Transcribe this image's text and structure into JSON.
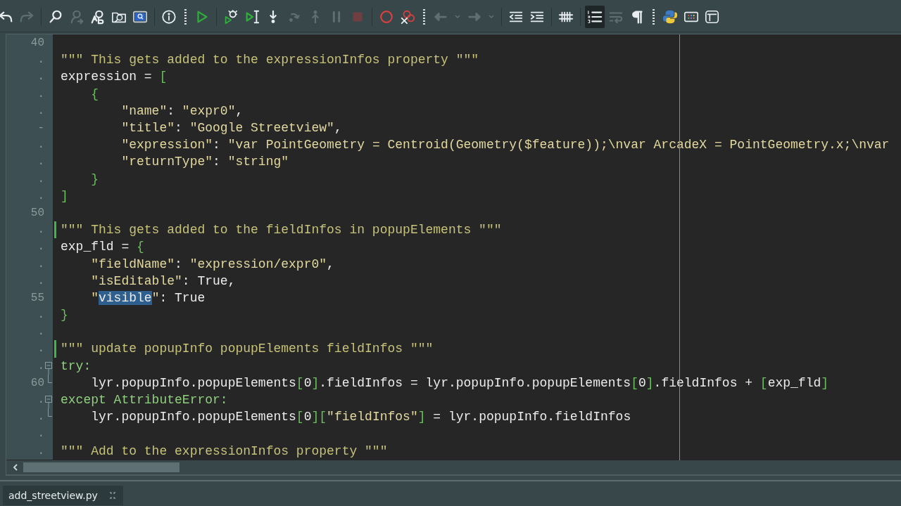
{
  "toolbar": {
    "groups": [
      {
        "kind": "plain",
        "buttons": [
          {
            "kind": "undo",
            "disabled": false,
            "selected": false
          },
          {
            "kind": "redo",
            "disabled": true,
            "selected": false
          }
        ]
      },
      {
        "kind": "plain",
        "buttons": [
          {
            "kind": "find",
            "disabled": false,
            "selected": false
          },
          {
            "kind": "find-user",
            "disabled": true,
            "selected": false
          },
          {
            "kind": "replace",
            "disabled": false,
            "selected": false
          },
          {
            "kind": "find-files",
            "disabled": false,
            "selected": false
          },
          {
            "kind": "search-box",
            "disabled": false,
            "selected": false
          }
        ]
      },
      {
        "kind": "plain",
        "buttons": [
          {
            "kind": "info",
            "disabled": false,
            "selected": false
          }
        ]
      },
      {
        "kind": "grip",
        "buttons": [
          {
            "kind": "run",
            "disabled": false,
            "selected": false
          }
        ]
      },
      {
        "kind": "plain",
        "buttons": [
          {
            "kind": "debug",
            "disabled": false,
            "selected": false
          },
          {
            "kind": "run-to-cursor",
            "disabled": false,
            "selected": false
          },
          {
            "kind": "step-into",
            "disabled": false,
            "selected": false
          },
          {
            "kind": "step-over",
            "disabled": true,
            "selected": false
          },
          {
            "kind": "step-out",
            "disabled": true,
            "selected": false
          },
          {
            "kind": "pause",
            "disabled": true,
            "selected": false
          },
          {
            "kind": "stop",
            "disabled": true,
            "selected": false
          }
        ]
      },
      {
        "kind": "plain",
        "buttons": [
          {
            "kind": "breakpoint",
            "disabled": false,
            "selected": false
          },
          {
            "kind": "clear-breakpoints",
            "disabled": false,
            "selected": false
          }
        ]
      },
      {
        "kind": "grip",
        "buttons": [
          {
            "kind": "back",
            "disabled": true,
            "selected": false
          },
          {
            "kind": "menu",
            "disabled": true,
            "selected": false
          },
          {
            "kind": "forward",
            "disabled": true,
            "selected": false
          },
          {
            "kind": "menu",
            "disabled": true,
            "selected": false
          }
        ]
      },
      {
        "kind": "plain",
        "buttons": [
          {
            "kind": "unindent",
            "disabled": false,
            "selected": false
          },
          {
            "kind": "indent",
            "disabled": false,
            "selected": false
          }
        ]
      },
      {
        "kind": "plain",
        "buttons": [
          {
            "kind": "hash",
            "disabled": false,
            "selected": false
          }
        ]
      },
      {
        "kind": "plain",
        "buttons": [
          {
            "kind": "line-numbers",
            "disabled": false,
            "selected": true
          },
          {
            "kind": "wrap",
            "disabled": true,
            "selected": false
          },
          {
            "kind": "pilcrow",
            "disabled": false,
            "selected": false
          }
        ]
      },
      {
        "kind": "grip",
        "buttons": [
          {
            "kind": "python",
            "disabled": false,
            "selected": false
          },
          {
            "kind": "color-grid",
            "disabled": false,
            "selected": false
          },
          {
            "kind": "layout",
            "disabled": false,
            "selected": false
          }
        ]
      }
    ]
  },
  "editor": {
    "lines": [
      {
        "number": "40",
        "changed": false
      },
      {
        "number": ".",
        "changed": false,
        "tokens": [
          {
            "kind": "doc",
            "text": "\"\"\" This gets added to the expressionInfos property \"\"\""
          }
        ]
      },
      {
        "number": ".",
        "changed": false,
        "tokens": [
          {
            "kind": "plain",
            "text": "expression = "
          },
          {
            "kind": "punct",
            "text": "["
          }
        ]
      },
      {
        "number": ".",
        "changed": false,
        "tokens": [
          {
            "kind": "punct",
            "text": "    {"
          }
        ]
      },
      {
        "number": ".",
        "changed": false,
        "tokens": [
          {
            "kind": "str",
            "text": "        \"name\""
          },
          {
            "kind": "plain",
            "text": ": "
          },
          {
            "kind": "str",
            "text": "\"expr0\""
          },
          {
            "kind": "plain",
            "text": ","
          }
        ]
      },
      {
        "number": "-",
        "changed": false,
        "tokens": [
          {
            "kind": "str",
            "text": "        \"title\""
          },
          {
            "kind": "plain",
            "text": ": "
          },
          {
            "kind": "str",
            "text": "\"Google Streetview\""
          },
          {
            "kind": "plain",
            "text": ","
          }
        ]
      },
      {
        "number": ".",
        "changed": false,
        "tokens": [
          {
            "kind": "str",
            "text": "        \"expression\""
          },
          {
            "kind": "plain",
            "text": ": "
          },
          {
            "kind": "str",
            "text": "\"var PointGeometry = Centroid(Geometry($feature));\\nvar ArcadeX = PointGeometry.x;\\nvar"
          }
        ]
      },
      {
        "number": ".",
        "changed": false,
        "tokens": [
          {
            "kind": "str",
            "text": "        \"returnType\""
          },
          {
            "kind": "plain",
            "text": ": "
          },
          {
            "kind": "str",
            "text": "\"string\""
          }
        ]
      },
      {
        "number": ".",
        "changed": false,
        "tokens": [
          {
            "kind": "punct",
            "text": "    }"
          }
        ]
      },
      {
        "number": ".",
        "changed": false,
        "tokens": [
          {
            "kind": "punct",
            "text": "]"
          }
        ]
      },
      {
        "number": "50",
        "changed": false
      },
      {
        "number": ".",
        "changed": true,
        "tokens": [
          {
            "kind": "doc",
            "text": "\"\"\" This gets added to the fieldInfos in popupElements \"\"\""
          }
        ]
      },
      {
        "number": ".",
        "changed": false,
        "tokens": [
          {
            "kind": "plain",
            "text": "exp_fld = "
          },
          {
            "kind": "punct",
            "text": "{"
          }
        ]
      },
      {
        "number": ".",
        "changed": false,
        "tokens": [
          {
            "kind": "str",
            "text": "    \"fieldName\""
          },
          {
            "kind": "plain",
            "text": ": "
          },
          {
            "kind": "str",
            "text": "\"expression/expr0\""
          },
          {
            "kind": "plain",
            "text": ","
          }
        ]
      },
      {
        "number": ".",
        "changed": false,
        "tokens": [
          {
            "kind": "str",
            "text": "    \"isEditable\""
          },
          {
            "kind": "plain",
            "text": ": True,"
          }
        ]
      },
      {
        "number": "55",
        "changed": false,
        "tokens": [
          {
            "kind": "str",
            "text": "    \""
          },
          {
            "kind": "sel",
            "text": "visible"
          },
          {
            "kind": "str",
            "text": "\""
          },
          {
            "kind": "plain",
            "text": ": True"
          }
        ]
      },
      {
        "number": ".",
        "changed": false,
        "tokens": [
          {
            "kind": "punct",
            "text": "}"
          }
        ]
      },
      {
        "number": ".",
        "changed": false
      },
      {
        "number": ".",
        "changed": true,
        "tokens": [
          {
            "kind": "doc",
            "text": "\"\"\" update popupInfo popupElements fieldInfos \"\"\""
          }
        ]
      },
      {
        "number": ".",
        "changed": false,
        "kind": "fold-start",
        "tokens": [
          {
            "kind": "kw",
            "text": "try:"
          }
        ]
      },
      {
        "number": "60",
        "changed": false,
        "kind": "fold-end",
        "tokens": [
          {
            "kind": "plain",
            "text": "    lyr.popupInfo.popupElements"
          },
          {
            "kind": "punct",
            "text": "["
          },
          {
            "kind": "plain",
            "text": "0"
          },
          {
            "kind": "punct",
            "text": "]"
          },
          {
            "kind": "plain",
            "text": ".fieldInfos = lyr.popupInfo.popupElements"
          },
          {
            "kind": "punct",
            "text": "["
          },
          {
            "kind": "plain",
            "text": "0"
          },
          {
            "kind": "punct",
            "text": "]"
          },
          {
            "kind": "plain",
            "text": ".fieldInfos + "
          },
          {
            "kind": "punct",
            "text": "["
          },
          {
            "kind": "plain",
            "text": "exp_fld"
          },
          {
            "kind": "punct",
            "text": "]"
          }
        ]
      },
      {
        "number": ".",
        "changed": false,
        "kind": "fold-start",
        "tokens": [
          {
            "kind": "kw",
            "text": "except AttributeError:"
          }
        ]
      },
      {
        "number": ".",
        "changed": false,
        "kind": "fold-end",
        "tokens": [
          {
            "kind": "plain",
            "text": "    lyr.popupInfo.popupElements"
          },
          {
            "kind": "punct",
            "text": "["
          },
          {
            "kind": "plain",
            "text": "0"
          },
          {
            "kind": "punct",
            "text": "]["
          },
          {
            "kind": "str",
            "text": "\"fieldInfos\""
          },
          {
            "kind": "punct",
            "text": "]"
          },
          {
            "kind": "plain",
            "text": " = lyr.popupInfo.fieldInfos"
          }
        ]
      },
      {
        "number": ".",
        "changed": false
      },
      {
        "number": ".",
        "changed": false,
        "tokens": [
          {
            "kind": "doc",
            "text": "\"\"\" Add to the expressionInfos property \"\"\""
          }
        ]
      }
    ]
  },
  "file_tabs": [
    {
      "label": "add_streetview.py",
      "selected": true
    }
  ]
}
